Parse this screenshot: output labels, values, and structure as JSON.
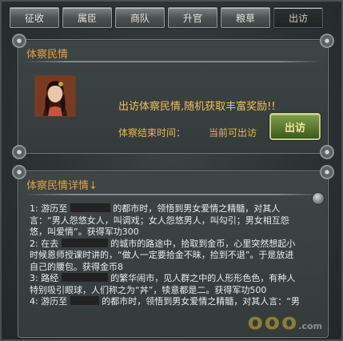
{
  "tabs": [
    {
      "label": "征收",
      "active": false
    },
    {
      "label": "属臣",
      "active": false
    },
    {
      "label": "商队",
      "active": false
    },
    {
      "label": "升官",
      "active": false
    },
    {
      "label": "粮草",
      "active": false
    },
    {
      "label": "出访",
      "active": true
    }
  ],
  "panel_top": {
    "title": "体察民情",
    "promo_text": "出访体察民情,随机获取丰富奖励!!",
    "end_label": "体察结束时间：",
    "end_value": "当前可出访",
    "visit_button": "出访"
  },
  "panel_detail": {
    "title": "体察民情详情↓",
    "entries": [
      {
        "prefix": "1: 游历至",
        "text": "的都市时，领悟到男女爱情之精髓，对其人言：“男人怨悠女人，叫调戏；女人怨悠男人，叫勾引；男女相互怨悠，叫爱情”。获得军功300"
      },
      {
        "prefix": "2: 在去",
        "text": "的城市的路途中，拾取到金币，心里突然想起小时候恩师授课时讲的，“做人一定要拾金不昧，捡到不退”。于是放进自己的腰包。获得金币8"
      },
      {
        "prefix": "3: 路经",
        "text": "的繁华闹市，见人群之中的人形形色色，有种人特别吸引眼球，人们称之为“丼”，犊意都是二。获得军功500"
      },
      {
        "prefix": "4: 游历至",
        "text": "的都市时，领悟到男女爱情之精髓，对其人言：“男"
      }
    ]
  },
  "watermark": {
    "main": "ooo",
    "sub": ".com"
  },
  "colors": {
    "accent": "#e3a33e",
    "button": "#5c7d2e"
  }
}
